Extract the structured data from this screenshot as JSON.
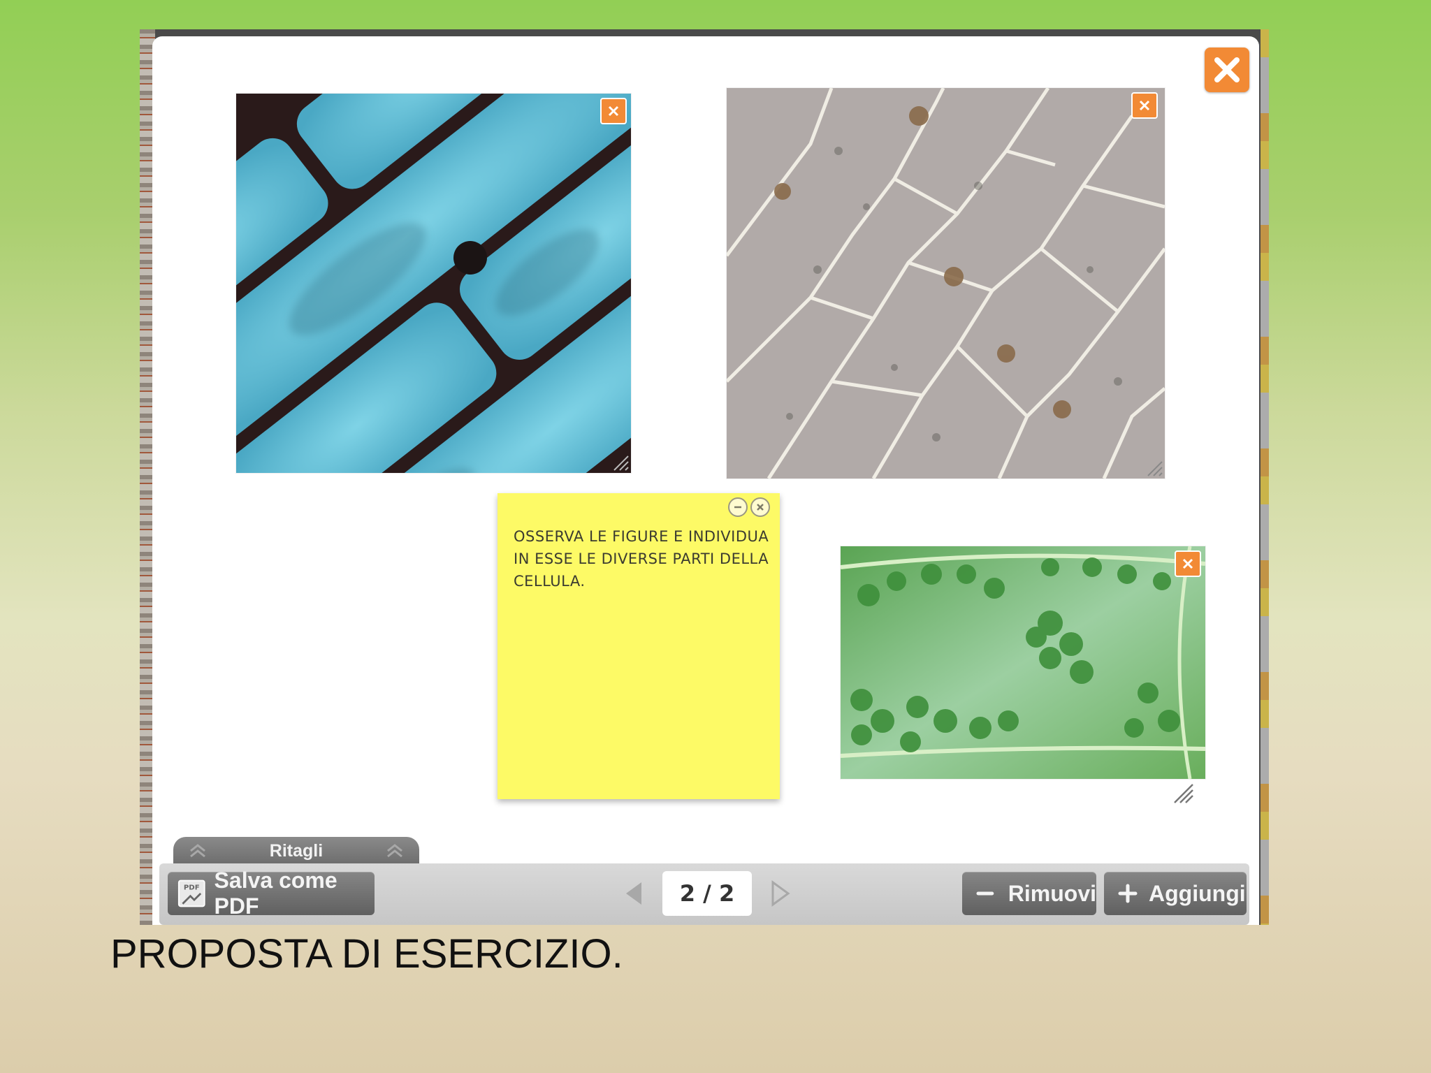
{
  "viewer": {
    "note": {
      "text": "OSSERVA LE  FIGURE E INDIVIDUA IN ESSE LE DIVERSE PARTI DELLA CELLULA."
    },
    "toolbar": {
      "tab_label": "Ritagli",
      "save_pdf_label": "Salva come PDF",
      "pdf_icon_text": "PDF",
      "page_indicator": "2 / 2",
      "remove_label": "Rimuovi",
      "add_label": "Aggiungi"
    },
    "clips": [
      {
        "subject": "onion epidermis cells, blue fluorescence micrograph"
      },
      {
        "subject": "onion epidermis cells, light micrograph with nuclei"
      },
      {
        "subject": "plant cell with green chloroplasts"
      }
    ]
  },
  "caption": "PROPOSTA DI ESERCIZIO.",
  "colors": {
    "accent_orange": "#f28a35",
    "note_yellow": "#fdfa66",
    "toolbar_button": "#6d6d6d"
  }
}
